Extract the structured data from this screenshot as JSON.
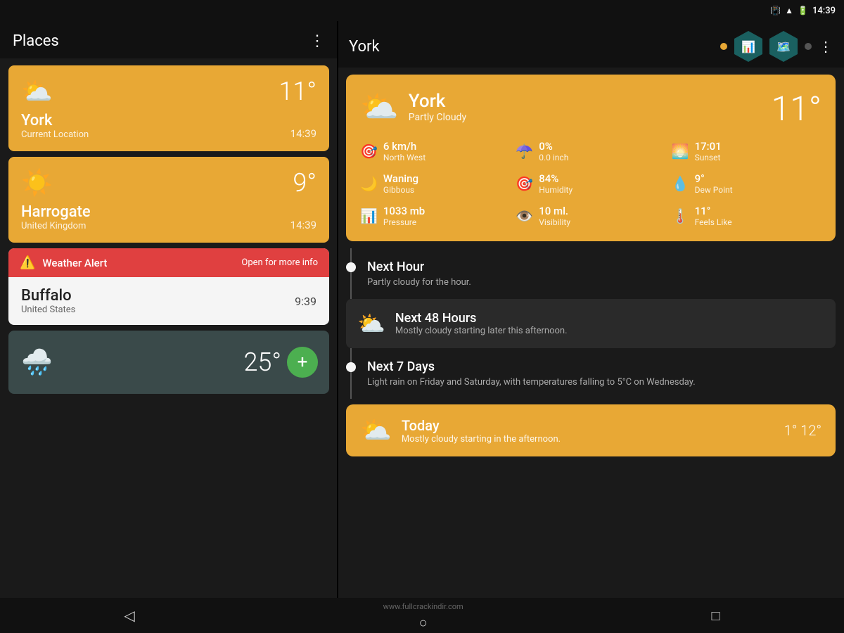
{
  "statusBar": {
    "time": "14:39",
    "icons": [
      "vibrate",
      "wifi",
      "battery"
    ]
  },
  "leftPanel": {
    "title": "Places",
    "menuIcon": "⋮",
    "cards": [
      {
        "id": "york",
        "city": "York",
        "subtitle": "Current Location",
        "temp": "11°",
        "time": "14:39",
        "type": "amber",
        "icon": "⛅"
      },
      {
        "id": "harrogate",
        "city": "Harrogate",
        "subtitle": "United Kingdom",
        "temp": "9°",
        "time": "14:39",
        "type": "amber",
        "icon": "☀️"
      },
      {
        "id": "buffalo",
        "city": "Buffalo",
        "subtitle": "United States",
        "temp": "9:39",
        "type": "white",
        "alertText": "Weather Alert",
        "alertAction": "Open for more info"
      },
      {
        "id": "last",
        "temp": "25°",
        "type": "dark",
        "icon": "🌧️"
      }
    ],
    "addButton": "+"
  },
  "rightPanel": {
    "title": "York",
    "headerIcons": [
      "bar-chart",
      "map",
      "dots"
    ],
    "mainCard": {
      "city": "York",
      "condition": "Partly Cloudy",
      "temp": "11°",
      "icon": "⛅",
      "details": [
        {
          "icon": "🎯",
          "value": "6 km/h",
          "label": "North West"
        },
        {
          "icon": "☂️",
          "value": "0%",
          "label": "0.0 inch"
        },
        {
          "icon": "🌅",
          "value": "17:01",
          "label": "Sunset"
        },
        {
          "icon": "🌙",
          "value": "Waning",
          "label": "Gibbous"
        },
        {
          "icon": "🎯",
          "value": "84%",
          "label": "Humidity"
        },
        {
          "icon": "💧",
          "value": "9°",
          "label": "Dew Point"
        },
        {
          "icon": "📊",
          "value": "1033 mb",
          "label": "Pressure"
        },
        {
          "icon": "👁️",
          "value": "10 ml.",
          "label": "Visibility"
        },
        {
          "icon": "🌡️",
          "value": "11°",
          "label": "Feels Like"
        }
      ]
    },
    "timeline": [
      {
        "id": "next-hour",
        "title": "Next Hour",
        "description": "Partly cloudy for the hour.",
        "type": "plain"
      },
      {
        "id": "next-48",
        "title": "Next 48 Hours",
        "description": "Mostly cloudy starting later this afternoon.",
        "type": "dark-card",
        "icon": "⛅"
      },
      {
        "id": "next-7",
        "title": "Next 7 Days",
        "description": "Light rain on Friday and Saturday, with temperatures falling to 5°C on Wednesday.",
        "type": "plain"
      }
    ],
    "todayCard": {
      "title": "Today",
      "description": "Mostly cloudy starting in the afternoon.",
      "tempLow": "1°",
      "tempHigh": "12°",
      "icon": "⛅"
    }
  },
  "bottomBar": {
    "back": "◁",
    "home": "○",
    "recent": "□"
  },
  "footer": {
    "website": "www.fullcrackindir.com"
  }
}
